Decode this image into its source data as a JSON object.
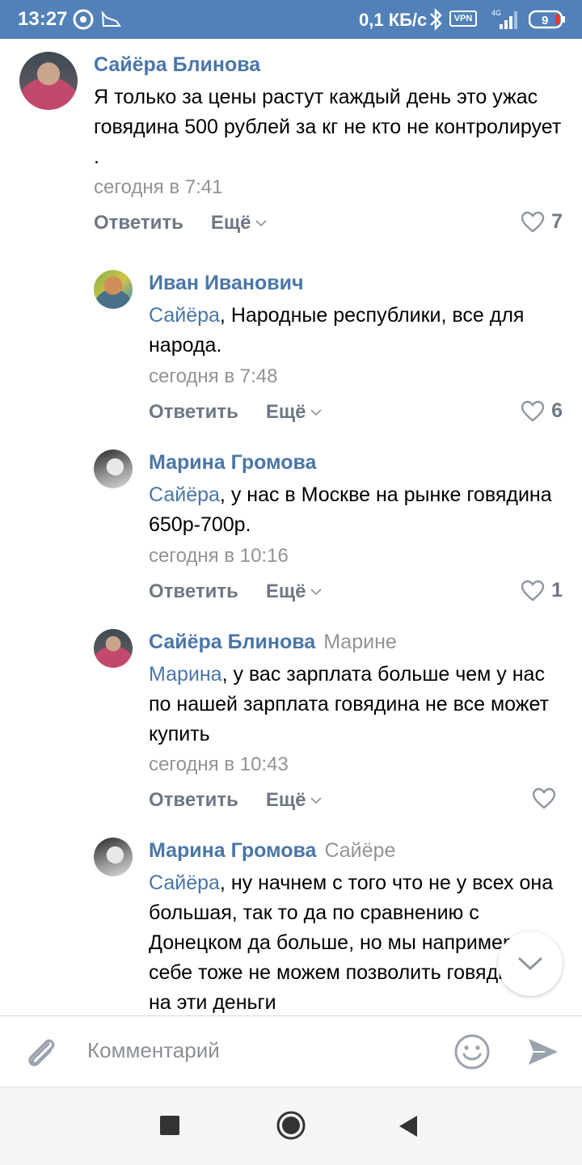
{
  "status_bar": {
    "time": "13:27",
    "speed": "0,1 КБ/с",
    "vpn": "VPN",
    "network": "4G",
    "battery": "9"
  },
  "comments": [
    {
      "author": "Сайёра Блинова",
      "reply_to": "",
      "mention": "",
      "text": "Я только за цены растут каждый день это ужас говядина 500 рублей за кг не кто не контролирует .",
      "time": "сегодня в 7:41",
      "likes": "7"
    },
    {
      "author": "Иван Иванович",
      "reply_to": "",
      "mention": "Сайёра",
      "text": ", Народные республики, все для народа.",
      "time": "сегодня в 7:48",
      "likes": "6"
    },
    {
      "author": "Марина Громова",
      "reply_to": "",
      "mention": "Сайёра",
      "text": ", у нас в Москве на рынке говядина 650р-700р.",
      "time": "сегодня в 10:16",
      "likes": "1"
    },
    {
      "author": "Сайёра Блинова",
      "reply_to": "Марине",
      "mention": "Марина",
      "text": ", у вас зарплата больше чем у нас по нашей зарплата говядина не все может купить",
      "time": "сегодня в 10:43",
      "likes": ""
    },
    {
      "author": "Марина Громова",
      "reply_to": "Сайёре",
      "mention": "Сайёра",
      "text": ", ну начнем с того что не у всех она большая, так то да по сравнению с Донецком да больше, но мы например себе тоже не можем позволить говядинку, я на эти деньги",
      "time": "",
      "likes": ""
    }
  ],
  "actions": {
    "reply_label": "Ответить",
    "more_label": "Ещё"
  },
  "input": {
    "placeholder": "Комментарий",
    "value": ""
  },
  "colors": {
    "accent": "#4a76a8",
    "status_bar": "#5181b8",
    "secondary_text": "#939393"
  },
  "icons": [
    "chrome-icon",
    "notification-icon",
    "bluetooth-icon",
    "signal-icon",
    "battery-icon",
    "heart-icon",
    "chevron-down-icon",
    "attach-icon",
    "emoji-icon",
    "send-icon",
    "nav-recents-icon",
    "nav-home-icon",
    "nav-back-icon"
  ]
}
